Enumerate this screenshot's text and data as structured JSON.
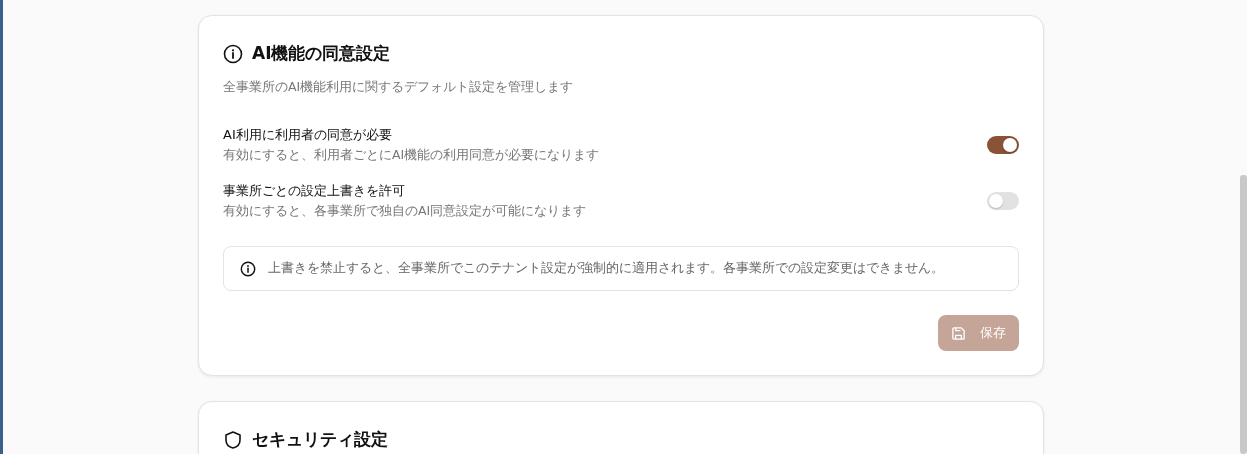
{
  "cards": [
    {
      "title": "AI機能の同意設定",
      "description": "全事業所のAI機能利用に関するデフォルト設定を管理します",
      "settings": [
        {
          "label": "AI利用に利用者の同意が必要",
          "description": "有効にすると、利用者ごとにAI機能の利用同意が必要になります",
          "on": true
        },
        {
          "label": "事業所ごとの設定上書きを許可",
          "description": "有効にすると、各事業所で独自のAI同意設定が可能になります",
          "on": false
        }
      ],
      "notice": "上書きを禁止すると、全事業所でこのテナント設定が強制的に適用されます。各事業所での設定変更はできません。",
      "button": {
        "label": "保存",
        "disabled": true
      }
    },
    {
      "title": "セキュリティ設定"
    }
  ]
}
